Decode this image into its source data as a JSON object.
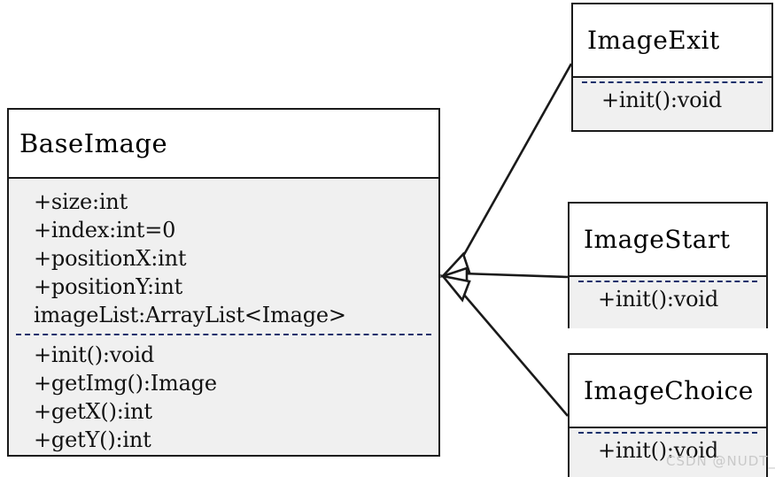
{
  "diagram": {
    "type": "uml-class-diagram",
    "relationship": "generalization",
    "watermark": "CSDN @NUDT_XX",
    "classes": [
      {
        "id": "BaseImage",
        "name": "BaseImage",
        "role": "superclass",
        "attributes": [
          "+size:int",
          "+index:int=0",
          "+positionX:int",
          "+positionY:int",
          "imageList:ArrayList<Image>"
        ],
        "methods": [
          "+init():void",
          "+getImg():Image",
          "+getX():int",
          "+getY():int"
        ]
      },
      {
        "id": "ImageExit",
        "name": "ImageExit",
        "role": "subclass",
        "attributes": [],
        "methods": [
          "+init():void"
        ]
      },
      {
        "id": "ImageStart",
        "name": "ImageStart",
        "role": "subclass",
        "attributes": [],
        "methods": [
          "+init():void"
        ]
      },
      {
        "id": "ImageChoice",
        "name": "ImageChoice",
        "role": "subclass",
        "attributes": [],
        "methods": [
          "+init():void"
        ]
      }
    ],
    "edges": [
      {
        "from": "ImageExit",
        "to": "BaseImage",
        "kind": "generalization"
      },
      {
        "from": "ImageStart",
        "to": "BaseImage",
        "kind": "generalization"
      },
      {
        "from": "ImageChoice",
        "to": "BaseImage",
        "kind": "generalization"
      }
    ],
    "colors": {
      "stroke": "#1a1a1a",
      "body_fill": "#f0f0f0",
      "header_fill": "#ffffff",
      "separator": "#16306b",
      "watermark": "#c9c9c9"
    }
  }
}
